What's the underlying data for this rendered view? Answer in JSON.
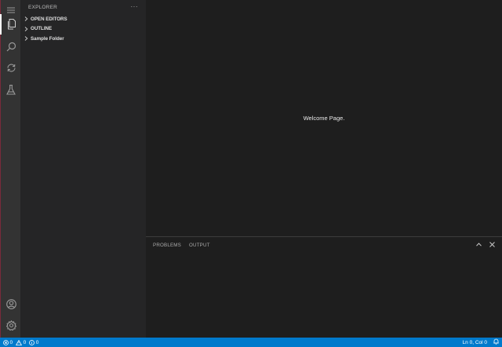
{
  "sidebar": {
    "title": "EXPLORER",
    "more": "···",
    "sections": [
      {
        "label": "OPEN EDITORS"
      },
      {
        "label": "OUTLINE"
      },
      {
        "label": "Sample Folder"
      }
    ]
  },
  "editor": {
    "welcome_text": "Welcome Page."
  },
  "panel": {
    "tabs": [
      "PROBLEMS",
      "OUTPUT"
    ]
  },
  "status": {
    "errors": "0",
    "warnings": "0",
    "info": "0",
    "cursor": "Ln 0, Col 0"
  },
  "colors": {
    "status_bar": "#007acc",
    "activity_bar": "#333333",
    "sidebar": "#252526",
    "editor": "#1e1e1e"
  }
}
